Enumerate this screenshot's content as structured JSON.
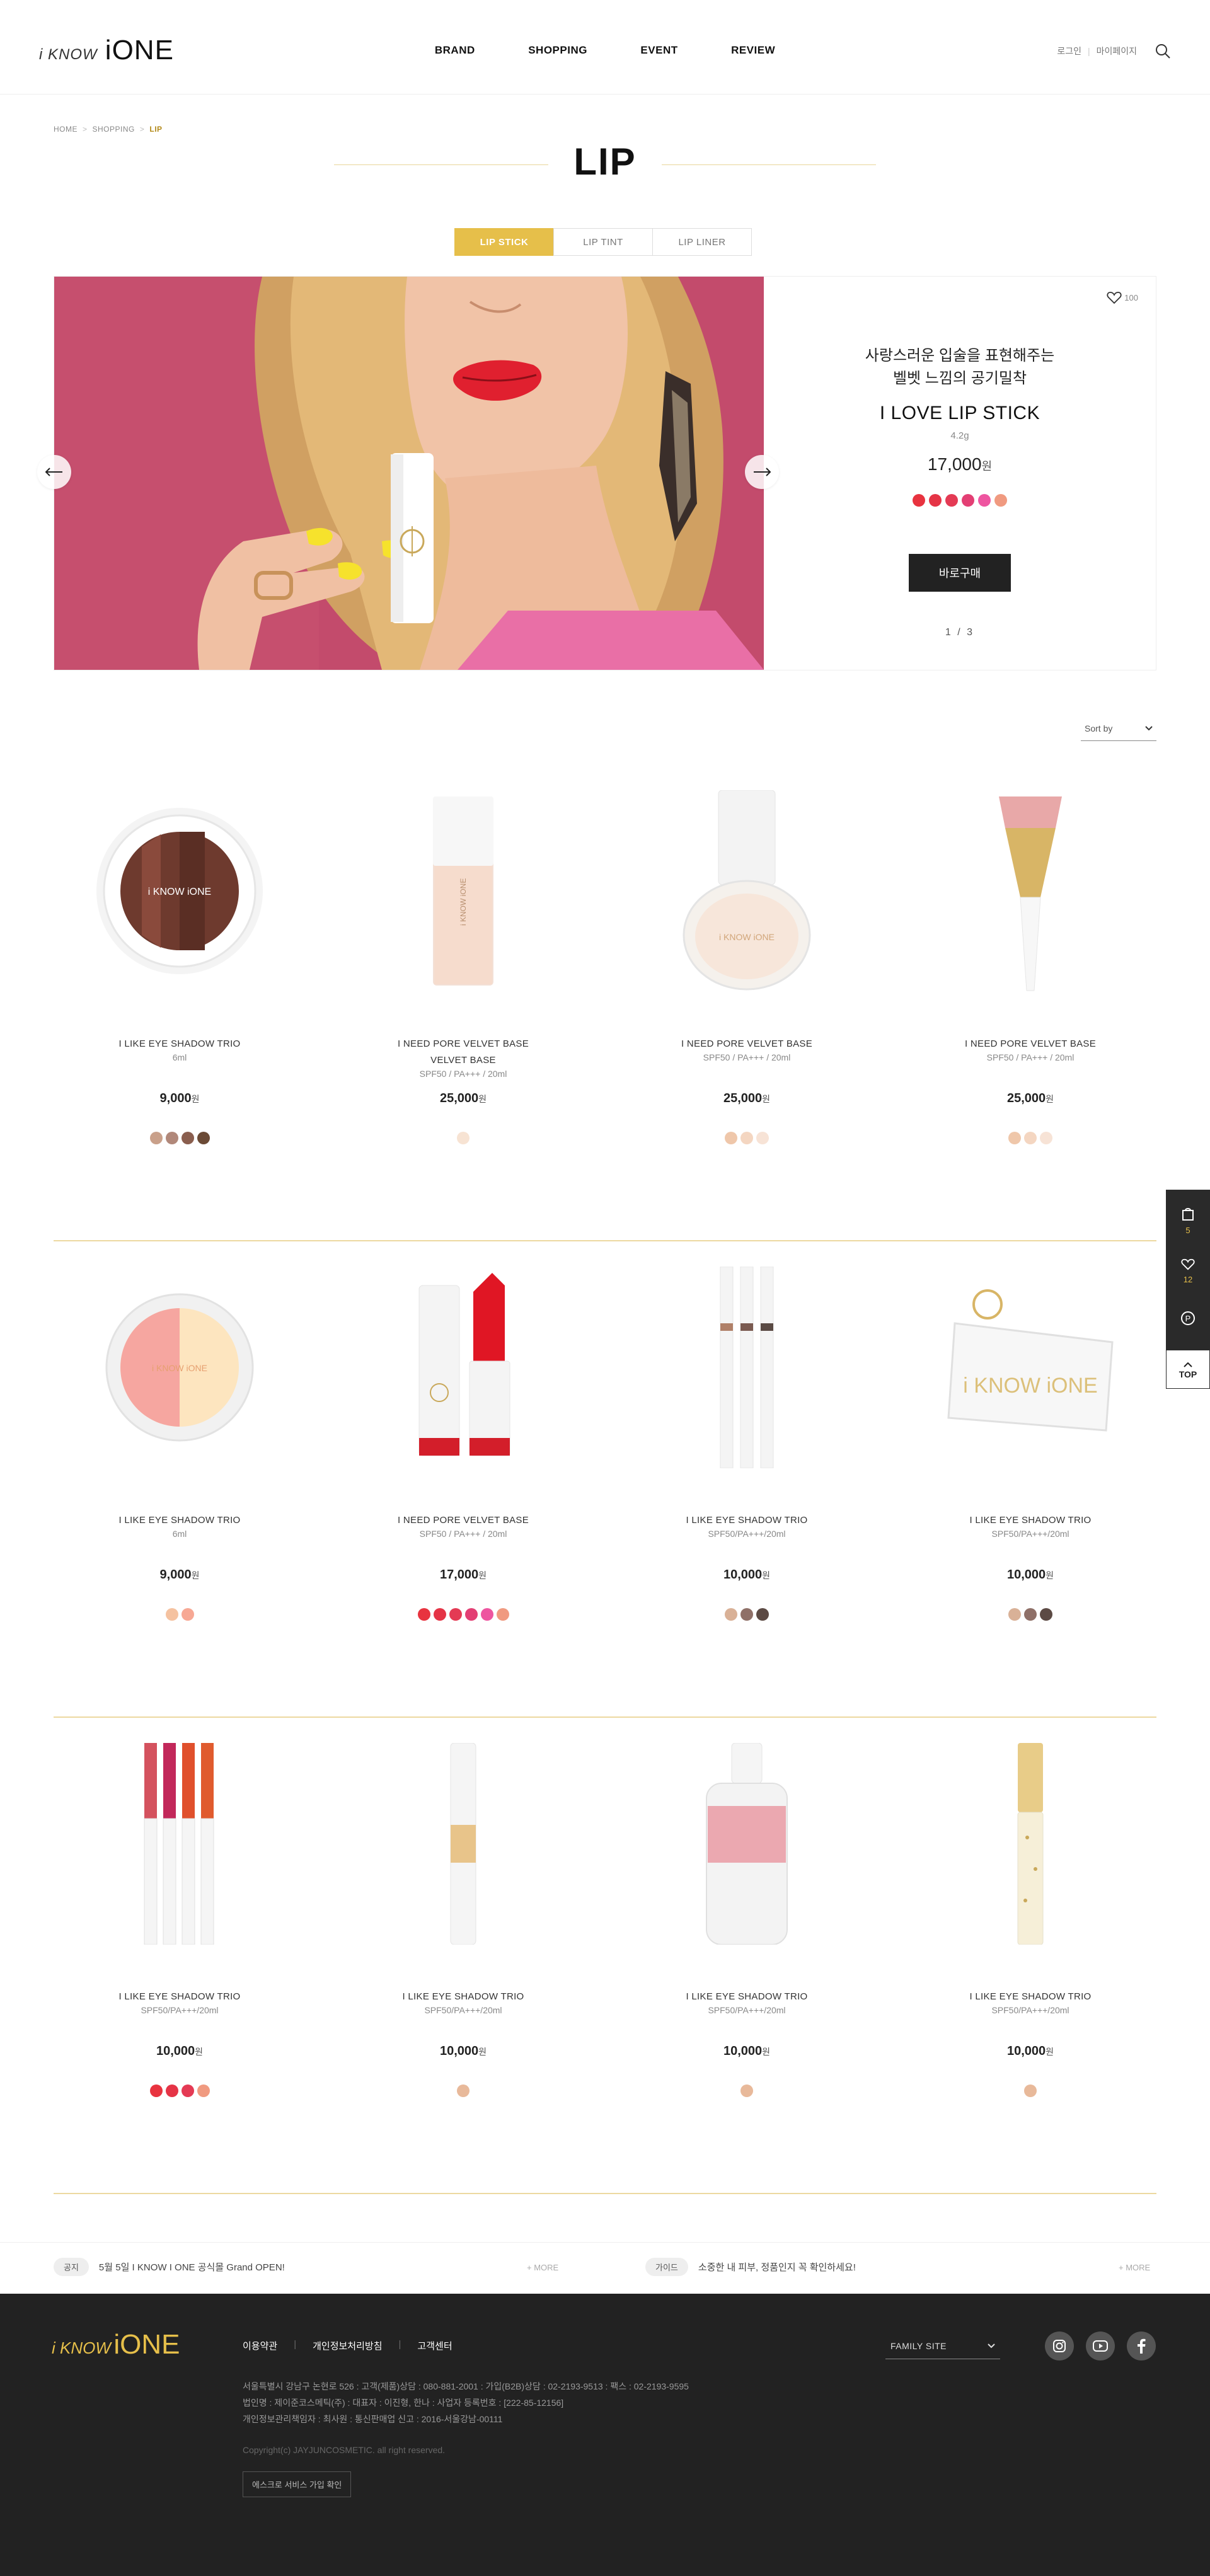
{
  "header": {
    "logo_small": "i KNOW",
    "logo_big": "iONE",
    "nav": [
      "BRAND",
      "SHOPPING",
      "EVENT",
      "REVIEW"
    ],
    "login": "로그인",
    "mypage": "마이페이지"
  },
  "breadcrumb": [
    "HOME",
    "SHOPPING",
    "LIP"
  ],
  "page_title": "LIP",
  "tabs": [
    "LIP STICK",
    "LIP TINT",
    "LIP LINER"
  ],
  "hero": {
    "desc_line1": "사랑스러운 입술을 표현해주는",
    "desc_line2": "벨벳 느낌의 공기밀착",
    "name": "I LOVE LIP STICK",
    "volume": "4.2g",
    "price": "17,000",
    "won": "원",
    "swatches": [
      "#e8333f",
      "#e53446",
      "#e43a54",
      "#e33f74",
      "#ee55a0",
      "#f09a80"
    ],
    "buy_label": "바로구매",
    "page": "1  /  3",
    "likes": "100"
  },
  "sort_label": "Sort by",
  "products": [
    {
      "name": "I LIKE EYE SHADOW TRIO",
      "name2": "",
      "spec": "6ml",
      "price": "9,000",
      "swatches": [
        "#c9a08a",
        "#b1887a",
        "#8a5e4e",
        "#6b4a36"
      ]
    },
    {
      "name": "I NEED PORE VELVET BASE",
      "name2": "VELVET BASE",
      "spec": "SPF50 / PA+++ / 20ml",
      "price": "25,000",
      "swatches": [
        "#f7e3d3"
      ]
    },
    {
      "name": "I NEED PORE VELVET BASE",
      "name2": "",
      "spec": "SPF50 / PA+++ / 20ml",
      "price": "25,000",
      "swatches": [
        "#efc7aa",
        "#f4d6c1",
        "#f7e3d6"
      ]
    },
    {
      "name": "I NEED PORE VELVET BASE",
      "name2": "",
      "spec": "SPF50 / PA+++ / 20ml",
      "price": "25,000",
      "swatches": [
        "#efc7aa",
        "#f4d6c1",
        "#f7e3d6"
      ]
    },
    {
      "name": "I LIKE EYE SHADOW TRIO",
      "name2": "",
      "spec": "6ml",
      "price": "9,000",
      "swatches": [
        "#f5c2a0",
        "#f7a894"
      ]
    },
    {
      "name": "I NEED PORE VELVET BASE",
      "name2": "",
      "spec": "SPF50 / PA+++ / 20ml",
      "price": "17,000",
      "swatches": [
        "#e8333f",
        "#e53446",
        "#e43a54",
        "#e33f74",
        "#ee55a0",
        "#f09a80"
      ]
    },
    {
      "name": "I LIKE EYE SHADOW TRIO",
      "name2": "",
      "spec": "SPF50/PA+++/20ml",
      "price": "10,000",
      "swatches": [
        "#d9b197",
        "#8f7068",
        "#5c4a44"
      ]
    },
    {
      "name": "I LIKE EYE SHADOW TRIO",
      "name2": "",
      "spec": "SPF50/PA+++/20ml",
      "price": "10,000",
      "swatches": [
        "#d9b197",
        "#8f7068",
        "#5c4a44"
      ]
    },
    {
      "name": "I LIKE EYE SHADOW TRIO",
      "name2": "",
      "spec": "SPF50/PA+++/20ml",
      "price": "10,000",
      "swatches": [
        "#e8333f",
        "#e53446",
        "#e43a54",
        "#f09a80"
      ]
    },
    {
      "name": "I LIKE EYE SHADOW TRIO",
      "name2": "",
      "spec": "SPF50/PA+++/20ml",
      "price": "10,000",
      "swatches": [
        "#e8b99a"
      ]
    },
    {
      "name": "I LIKE EYE SHADOW TRIO",
      "name2": "",
      "spec": "SPF50/PA+++/20ml",
      "price": "10,000",
      "swatches": [
        "#e8b99a"
      ]
    },
    {
      "name": "I LIKE EYE SHADOW TRIO",
      "name2": "",
      "spec": "SPF50/PA+++/20ml",
      "price": "10,000",
      "swatches": [
        "#e8b99a"
      ]
    }
  ],
  "won": "원",
  "quick": {
    "cart_count": "5",
    "like_count": "12",
    "top": "TOP"
  },
  "notices": [
    {
      "badge": "공지",
      "text": "5월 5일 I KNOW I ONE 공식몰 Grand OPEN!",
      "more": "+ MORE"
    },
    {
      "badge": "가이드",
      "text": "소중한 내 피부, 정품인지 꼭 확인하세요!",
      "more": "+ MORE"
    }
  ],
  "footer": {
    "logo_small": "i KNOW",
    "logo_big": "iONE",
    "links": [
      "이용약관",
      "개인정보처리방침",
      "고객센터"
    ],
    "info1": "서울특별시 강남구 논현로 526  :  고객(제품)상담 : 080-881-2001  :  가입(B2B)상담 : 02-2193-9513  :  팩스 : 02-2193-9595",
    "info2": "법인명 : 제이준코스메틱(주)  :  대표자 : 이진형, 한나  :  사업자 등록번호 : [222-85-12156]",
    "info3": "개인정보관리책임자 : 최사원  :  통신판매업 신고 : 2016-서울강남-00111",
    "copyright": "Copyright(c) JAYJUNCOSMETIC. all right reserved.",
    "escrow": "에스크로 서비스 가입 확인",
    "family_site": "FAMILY SITE"
  },
  "colors": {
    "accent": "#e6bf4a",
    "footer_bg": "#222222"
  }
}
